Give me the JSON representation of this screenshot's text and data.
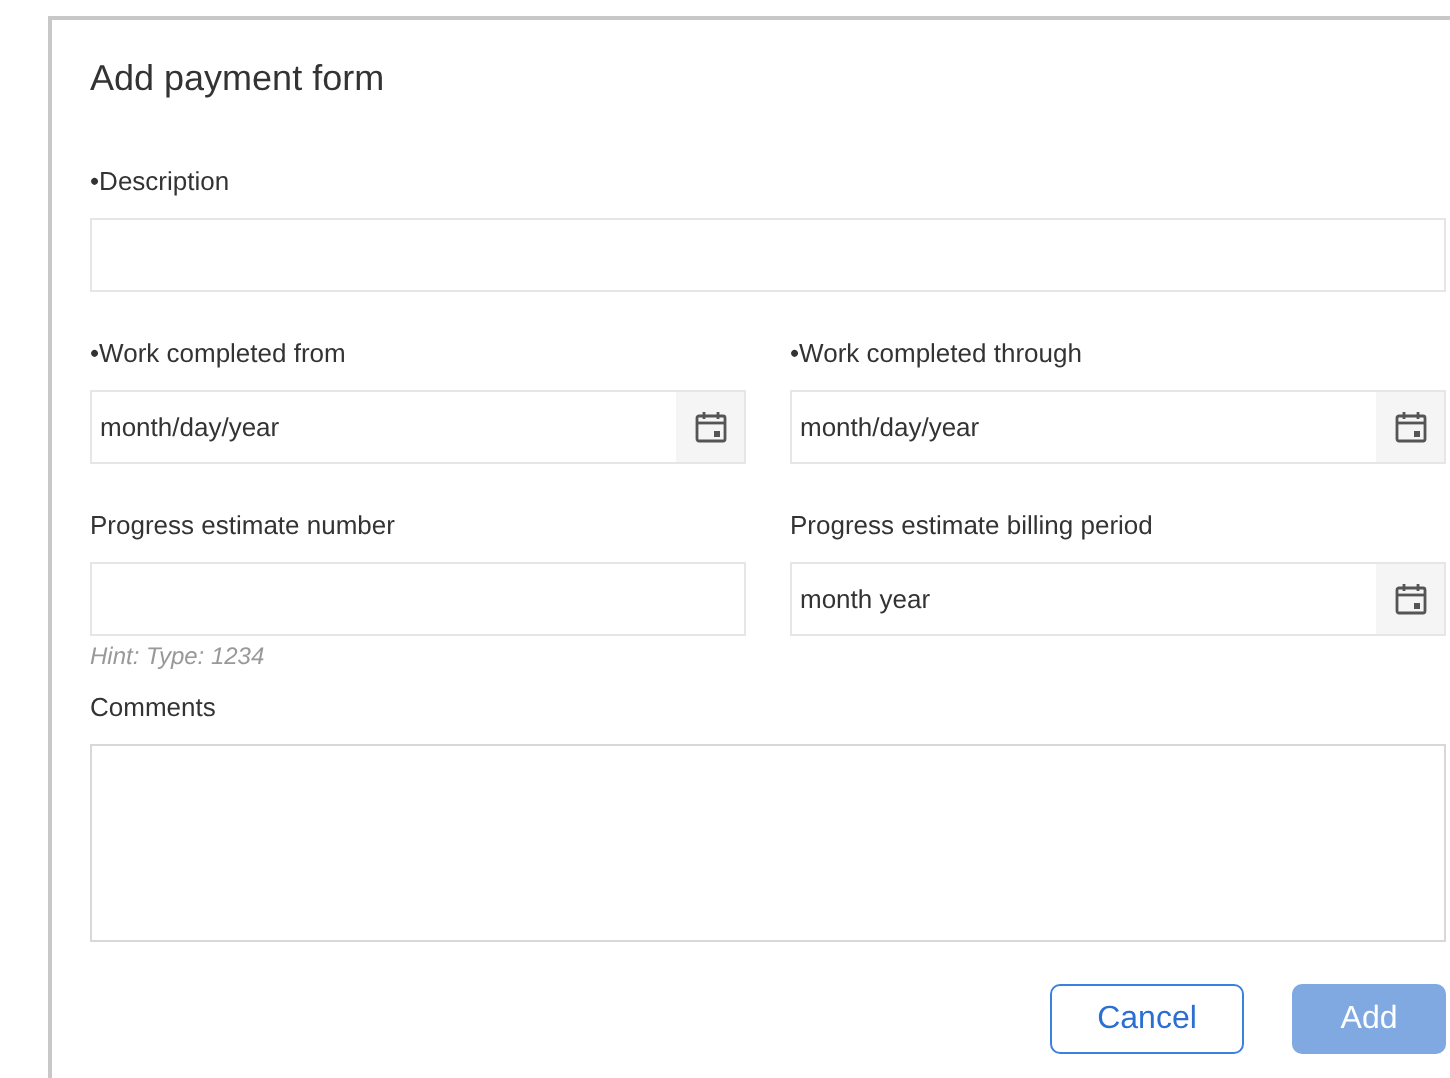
{
  "title": "Add payment form",
  "rows": [
    [
      {
        "kind": "text",
        "label": "•Description"
      }
    ],
    [
      {
        "kind": "date",
        "label": "•Work completed from",
        "value": "month/day/year"
      },
      {
        "kind": "date",
        "label": "•Work completed through",
        "value": "month/day/year"
      }
    ],
    [
      {
        "kind": "text",
        "label": "Progress estimate number",
        "hint": "Hint: Type: 1234"
      },
      {
        "kind": "date",
        "label": "Progress estimate billing period",
        "value": "month year"
      }
    ],
    [
      {
        "kind": "textarea",
        "label": "Comments"
      }
    ]
  ],
  "buttons": [
    {
      "label": "Cancel",
      "disabled": false,
      "kind": "secondary"
    },
    {
      "label": "Add",
      "disabled": true,
      "kind": "primary"
    }
  ]
}
